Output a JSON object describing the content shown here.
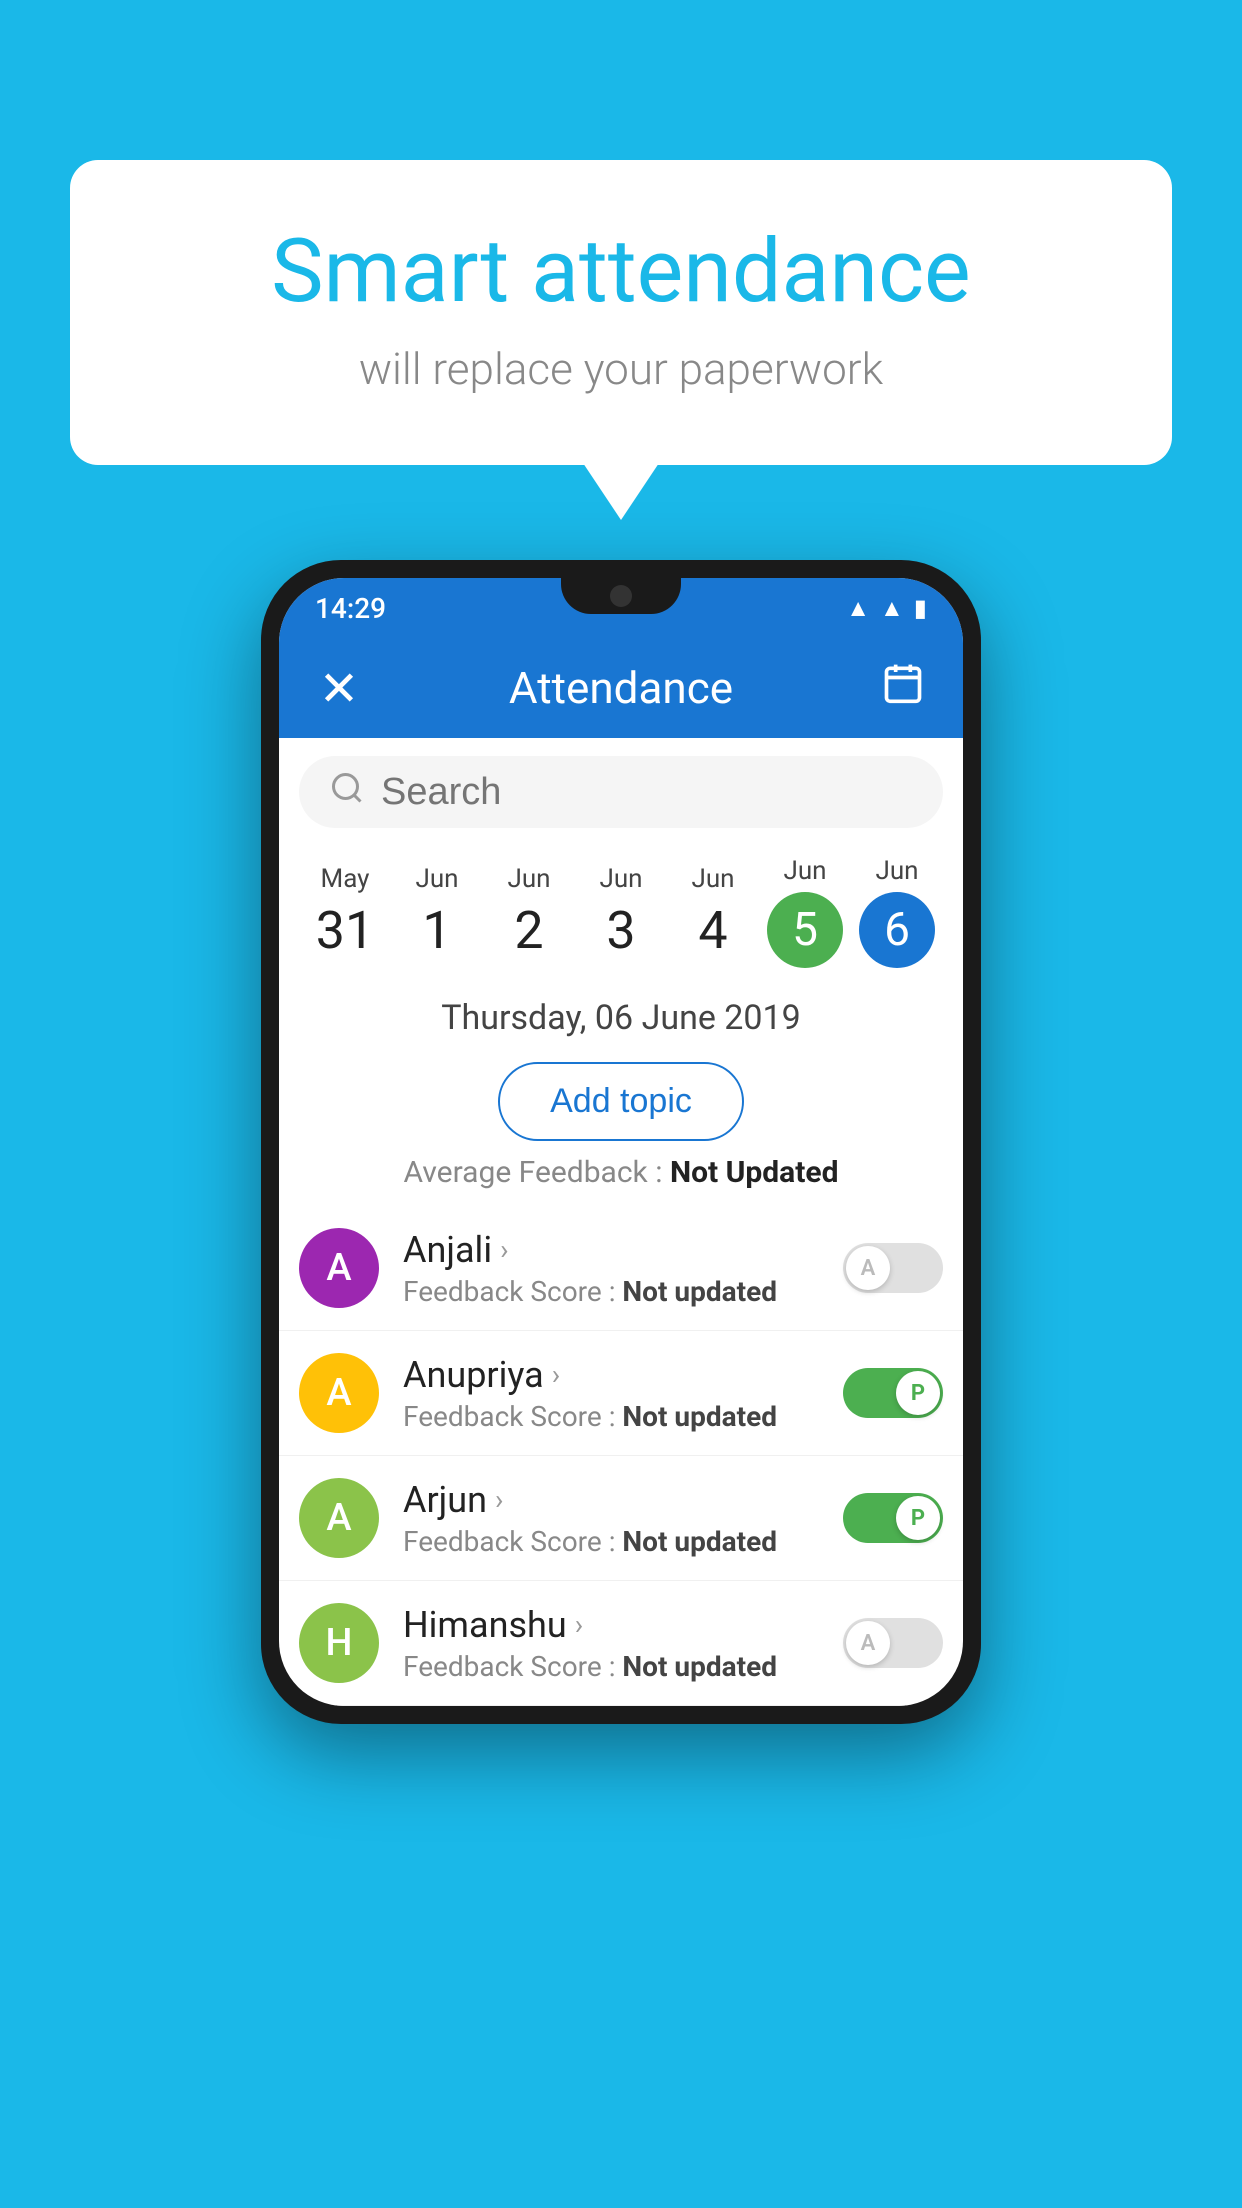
{
  "background_color": "#1ab8e8",
  "bubble": {
    "title": "Smart attendance",
    "subtitle": "will replace your paperwork"
  },
  "status_bar": {
    "time": "14:29",
    "icons": [
      "wifi",
      "signal",
      "battery"
    ]
  },
  "app_bar": {
    "title": "Attendance",
    "back_label": "×",
    "calendar_label": "📅"
  },
  "search": {
    "placeholder": "Search"
  },
  "dates": [
    {
      "month": "May",
      "day": "31",
      "state": "normal"
    },
    {
      "month": "Jun",
      "day": "1",
      "state": "normal"
    },
    {
      "month": "Jun",
      "day": "2",
      "state": "normal"
    },
    {
      "month": "Jun",
      "day": "3",
      "state": "normal"
    },
    {
      "month": "Jun",
      "day": "4",
      "state": "normal"
    },
    {
      "month": "Jun",
      "day": "5",
      "state": "today"
    },
    {
      "month": "Jun",
      "day": "6",
      "state": "selected"
    }
  ],
  "selected_date_label": "Thursday, 06 June 2019",
  "add_topic_label": "Add topic",
  "avg_feedback_label": "Average Feedback :",
  "avg_feedback_value": "Not Updated",
  "students": [
    {
      "name": "Anjali",
      "avatar_letter": "A",
      "avatar_color": "#9c27b0",
      "feedback_label": "Feedback Score :",
      "feedback_value": "Not updated",
      "toggle": "off",
      "toggle_letter": "A"
    },
    {
      "name": "Anupriya",
      "avatar_letter": "A",
      "avatar_color": "#ffc107",
      "feedback_label": "Feedback Score :",
      "feedback_value": "Not updated",
      "toggle": "on",
      "toggle_letter": "P"
    },
    {
      "name": "Arjun",
      "avatar_letter": "A",
      "avatar_color": "#8bc34a",
      "feedback_label": "Feedback Score :",
      "feedback_value": "Not updated",
      "toggle": "on",
      "toggle_letter": "P"
    },
    {
      "name": "Himanshu",
      "avatar_letter": "H",
      "avatar_color": "#8bc34a",
      "feedback_label": "Feedback Score :",
      "feedback_value": "Not updated",
      "toggle": "off",
      "toggle_letter": "A"
    }
  ]
}
